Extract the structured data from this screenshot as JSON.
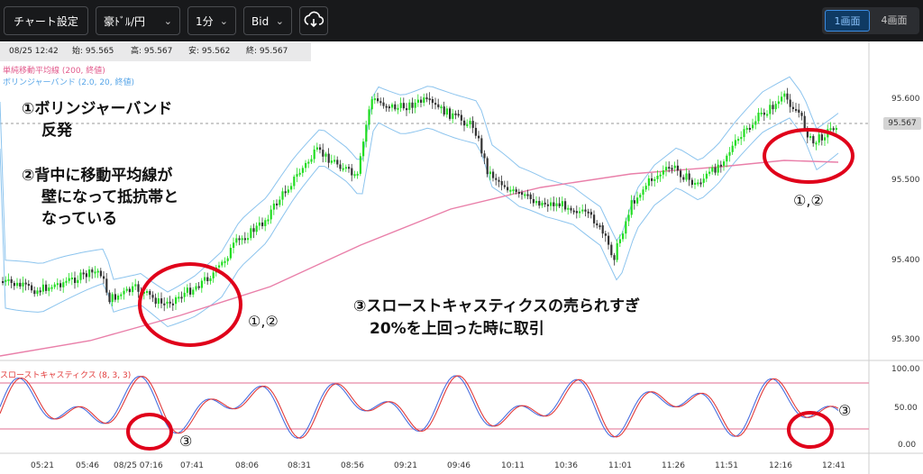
{
  "toolbar": {
    "chart_settings": "チャート設定",
    "symbol": "豪ﾄﾞﾙ/円",
    "interval": "1分",
    "price_side": "Bid",
    "download_icon": "cloud-download-icon",
    "layout_one": "1画面",
    "layout_four": "4画面"
  },
  "info": {
    "datetime": "08/25 12:42",
    "open": "始: 95.565",
    "high": "高: 95.567",
    "low": "安: 95.562",
    "close": "終: 95.567"
  },
  "legends": {
    "sma": "単純移動平均線 (200, 終値)",
    "bollinger": "ボリンジャーバンド (2.0, 20, 終値)",
    "stochastic": "スローストキャスティクス (8, 3, 3)"
  },
  "annotations": {
    "a1_line1": "①ボリンジャーバンド",
    "a1_line2": "反発",
    "a2_line1": "②背中に移動平均線が",
    "a2_line2": "壁になって抵抗帯と",
    "a2_line3": "なっている",
    "a3_line1": "③スローストキャスティクスの売られすぎ",
    "a3_line2": "20%を上回った時に取引",
    "mark_left": "①,②",
    "mark_right": "①,②",
    "mark3_left": "③",
    "mark3_right": "③"
  },
  "price_axis": {
    "labels": [
      "95.600",
      "95.500",
      "95.400",
      "95.300"
    ],
    "current_price": "95.567"
  },
  "osc_axis": {
    "labels": [
      "100.00",
      "50.00",
      "0.00"
    ]
  },
  "time_axis": {
    "labels": [
      "05:21",
      "05:46",
      "08/25 07:16",
      "07:41",
      "08:06",
      "08:31",
      "08:56",
      "09:21",
      "09:46",
      "10:11",
      "10:36",
      "11:01",
      "11:26",
      "11:51",
      "12:16",
      "12:41"
    ]
  },
  "colors": {
    "up_candle": "#22dd22",
    "down_candle": "#333333",
    "sma": "#e97fa9",
    "bollinger": "#8cc4ee",
    "stoch_k": "#4a6fe0",
    "stoch_d": "#e23b3b",
    "highlight": "#e0001a",
    "level_lines": "#e88aa8"
  }
}
